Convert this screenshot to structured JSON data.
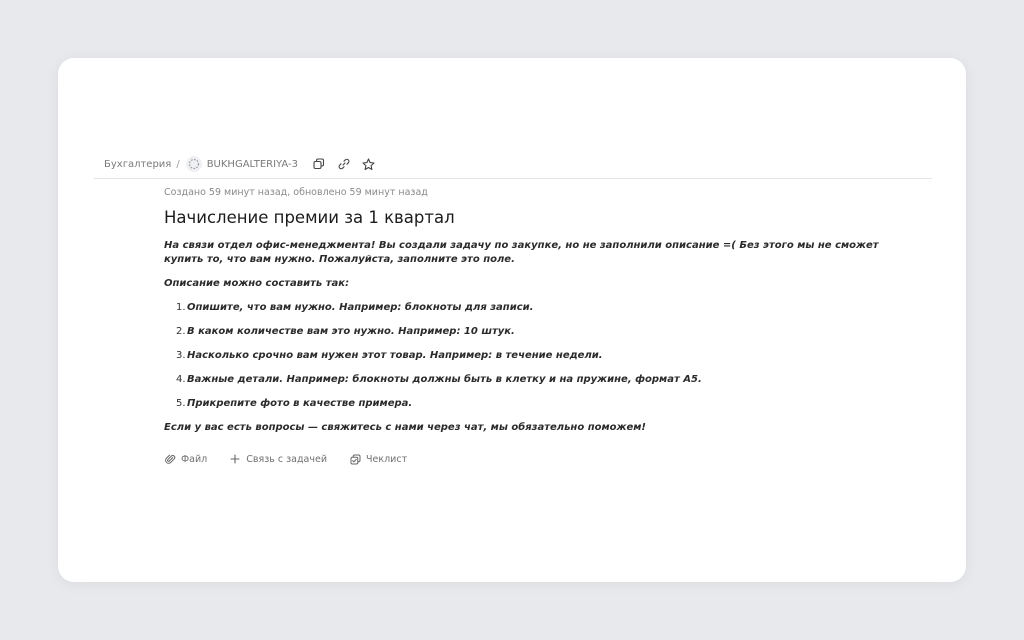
{
  "breadcrumb": {
    "queue": "Бухгалтерия",
    "separator": "/",
    "status_icon": "status-open-icon",
    "issue_key": "BUKHGALTERIYA-3",
    "tools": [
      "copy-icon",
      "link-icon",
      "star-icon"
    ]
  },
  "issue": {
    "meta": "Создано 59 минут назад, обновлено 59 минут назад",
    "title": "Начисление премии за 1 квартал",
    "intro": "На связи отдел офис-менеджмента! Вы создали задачу по закупке, но не заполнили описание  =( Без этого мы не сможет купить то, что вам нужно. Пожалуйста, заполните это поле.",
    "howto": "Описание можно составить так:",
    "steps": [
      {
        "num": "1.",
        "text": "Опишите, что вам нужно. Например: блокноты для записи."
      },
      {
        "num": "2.",
        "text": "В каком количестве вам это нужно. Например: 10 штук."
      },
      {
        "num": "3.",
        "text": "Насколько срочно вам нужен этот товар. Например: в течение недели."
      },
      {
        "num": "4.",
        "text": "Важные детали. Например: блокноты должны быть в клетку и на пружине, формат А5."
      },
      {
        "num": "5.",
        "text": "Прикрепите фото в качестве примера."
      }
    ],
    "outro": "Если у вас есть вопросы — свяжитесь с нами через чат, мы обязательно поможем!"
  },
  "actions": {
    "file_label": "Файл",
    "link_label": "Связь с задачей",
    "checklist_label": "Чеклист"
  },
  "colors": {
    "background": "#e7e9ec",
    "card": "#ffffff",
    "text": "#1f1f1f",
    "muted": "#7a7a7a"
  }
}
